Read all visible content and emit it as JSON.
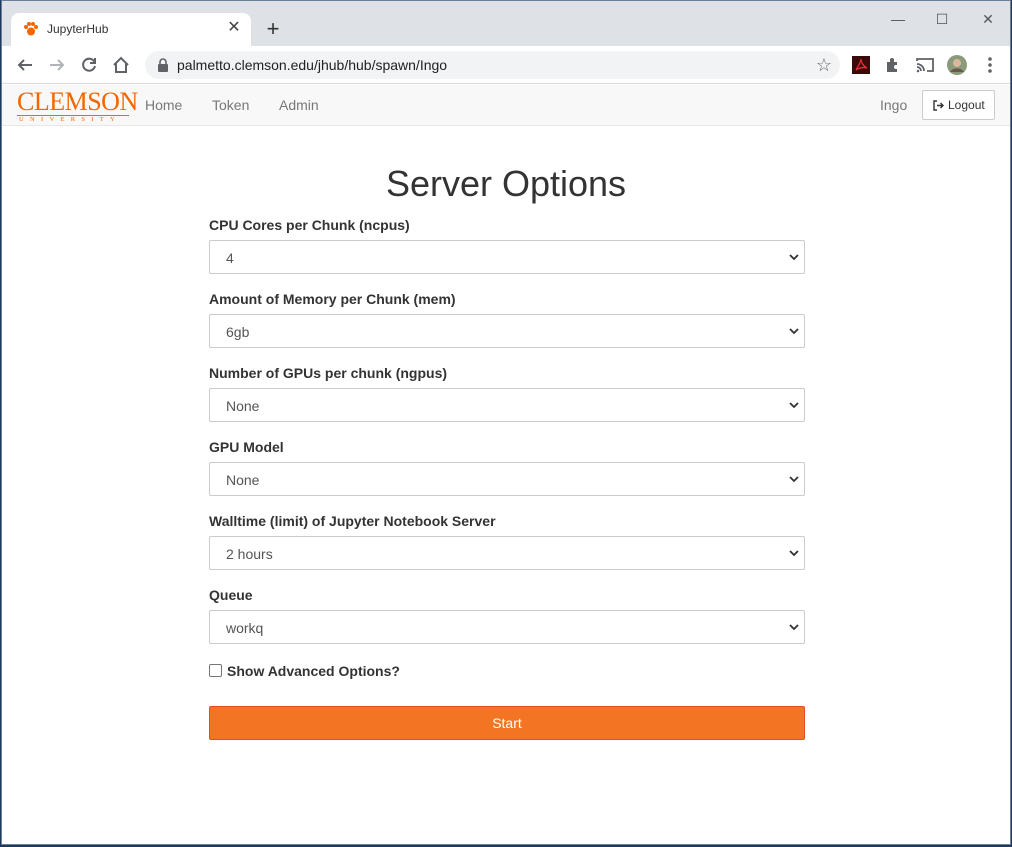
{
  "browser": {
    "tab_title": "JupyterHub",
    "tab_close": "✕",
    "new_tab": "+",
    "url": "palmetto.clemson.edu/jhub/hub/spawn/Ingo",
    "window_controls": {
      "minimize": "—",
      "maximize": "☐",
      "close": "✕"
    }
  },
  "navbar": {
    "logo_main": "CLEMSON",
    "logo_sub": "UNIVERSITY",
    "links": {
      "home": "Home",
      "token": "Token",
      "admin": "Admin"
    },
    "user": "Ingo",
    "logout": "Logout"
  },
  "form": {
    "title": "Server Options",
    "fields": [
      {
        "label": "CPU Cores per Chunk (ncpus)",
        "value": "4"
      },
      {
        "label": "Amount of Memory per Chunk (mem)",
        "value": "6gb"
      },
      {
        "label": "Number of GPUs per chunk (ngpus)",
        "value": "None"
      },
      {
        "label": "GPU Model",
        "value": "None"
      },
      {
        "label": "Walltime (limit) of Jupyter Notebook Server",
        "value": "2 hours"
      },
      {
        "label": "Queue",
        "value": "workq"
      }
    ],
    "advanced_label": "Show Advanced Options?",
    "advanced_checked": false,
    "submit": "Start"
  },
  "colors": {
    "brand": "#f56600",
    "button": "#f37524"
  }
}
